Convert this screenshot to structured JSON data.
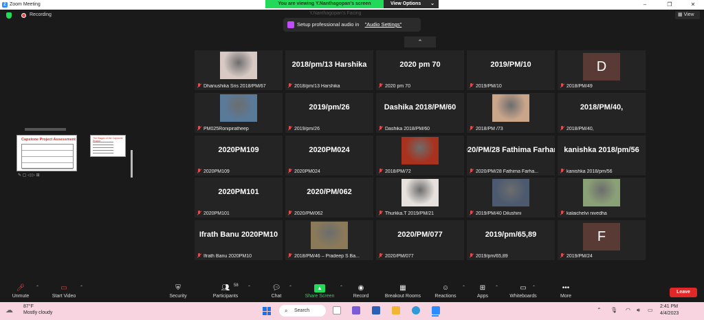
{
  "window": {
    "title": "Zoom Meeting",
    "viewing_banner": "You are viewing Y.Nanthagopan's screen",
    "view_options": "View Options",
    "minimize": "–",
    "maximize": "❐",
    "close": "✕"
  },
  "status": {
    "recording": "Recording",
    "view_button": "View",
    "presenter_ghost": "Y.Nanthagopan's Facing"
  },
  "audio_notice": {
    "text": "Setup professional audio in",
    "link": "\"Audio Settings\""
  },
  "shared_screen": {
    "slide_title": "Capstone Project Assessment",
    "slide2_title": "The Stages of the Capstone Project"
  },
  "tiles": [
    {
      "label": "",
      "name": "Dhanushika Sris 2018/PM/67",
      "kind": "photo",
      "color": "#d8c9c4"
    },
    {
      "label": "2018/pm/13  Harshika",
      "name": "2018/pm/13 Harshika",
      "kind": "text"
    },
    {
      "label": "2020 pm 70",
      "name": "2020 pm 70",
      "kind": "text"
    },
    {
      "label": "2019/PM/10",
      "name": "2019/PM/10",
      "kind": "text"
    },
    {
      "label": "D",
      "name": "2018/PM/49",
      "kind": "initial"
    },
    {
      "label": "",
      "name": "PM025Ronipiratheep",
      "kind": "photo",
      "color": "#5a7a9a"
    },
    {
      "label": "2019/pm/26",
      "name": "2019/pm/26",
      "kind": "text"
    },
    {
      "label": "Dashika  2018/PM/60",
      "name": "Dashika 2018/PM/60",
      "kind": "text"
    },
    {
      "label": "",
      "name": "2018/PM /73",
      "kind": "photo",
      "color": "#c9a58a"
    },
    {
      "label": "2018/PM/40,",
      "name": "2018/PM/40,",
      "kind": "text"
    },
    {
      "label": "2020PM109",
      "name": "2020PM109",
      "kind": "text"
    },
    {
      "label": "2020PM024",
      "name": "2020PM024",
      "kind": "text"
    },
    {
      "label": "",
      "name": "2018/PM/72",
      "kind": "photo",
      "color": "#a8321e"
    },
    {
      "label": "2020/PM/28  Fathima Farhana",
      "name": "2020/PM/28 Fathima Farha...",
      "kind": "text"
    },
    {
      "label": "kanishka  2018/pm/56",
      "name": "kanishka 2018/pm/56",
      "kind": "text"
    },
    {
      "label": "2020PM101",
      "name": "2020PM101",
      "kind": "text"
    },
    {
      "label": "2020/PM/062",
      "name": "2020/PM/062",
      "kind": "text"
    },
    {
      "label": "",
      "name": "Thurkka.T 2019/PM/21",
      "kind": "photo",
      "color": "#e6e1dc"
    },
    {
      "label": "",
      "name": "2019/PM/40 Dilushini",
      "kind": "photo",
      "color": "#4c5a70"
    },
    {
      "label": "",
      "name": "kalaichelvi nivedha",
      "kind": "photo",
      "color": "#8aa076"
    },
    {
      "label": "Ifrath Banu  2020PM10",
      "name": "Ifrath Banu 2020PM10",
      "kind": "text"
    },
    {
      "label": "",
      "name": "2018/PM/46 – Pradeep S Ba...",
      "kind": "photo",
      "color": "#8a7a58"
    },
    {
      "label": "2020/PM/077",
      "name": "2020/PM/077",
      "kind": "text"
    },
    {
      "label": "2019/pm/65,89",
      "name": "2019/pm/65,89",
      "kind": "text"
    },
    {
      "label": "F",
      "name": "2019/PM/24",
      "kind": "initial"
    }
  ],
  "toolbar": {
    "unmute": "Unmute",
    "start_video": "Start Video",
    "security": "Security",
    "participants": "Participants",
    "participants_count": "58",
    "chat": "Chat",
    "share_screen": "Share Screen",
    "record": "Record",
    "breakout": "Breakout Rooms",
    "reactions": "Reactions",
    "apps": "Apps",
    "whiteboards": "Whiteboards",
    "more": "More",
    "leave": "Leave"
  },
  "taskbar": {
    "temp": "87°F",
    "weather": "Mostly cloudy",
    "search": "Search",
    "time": "2:41 PM",
    "date": "4/4/2023"
  }
}
